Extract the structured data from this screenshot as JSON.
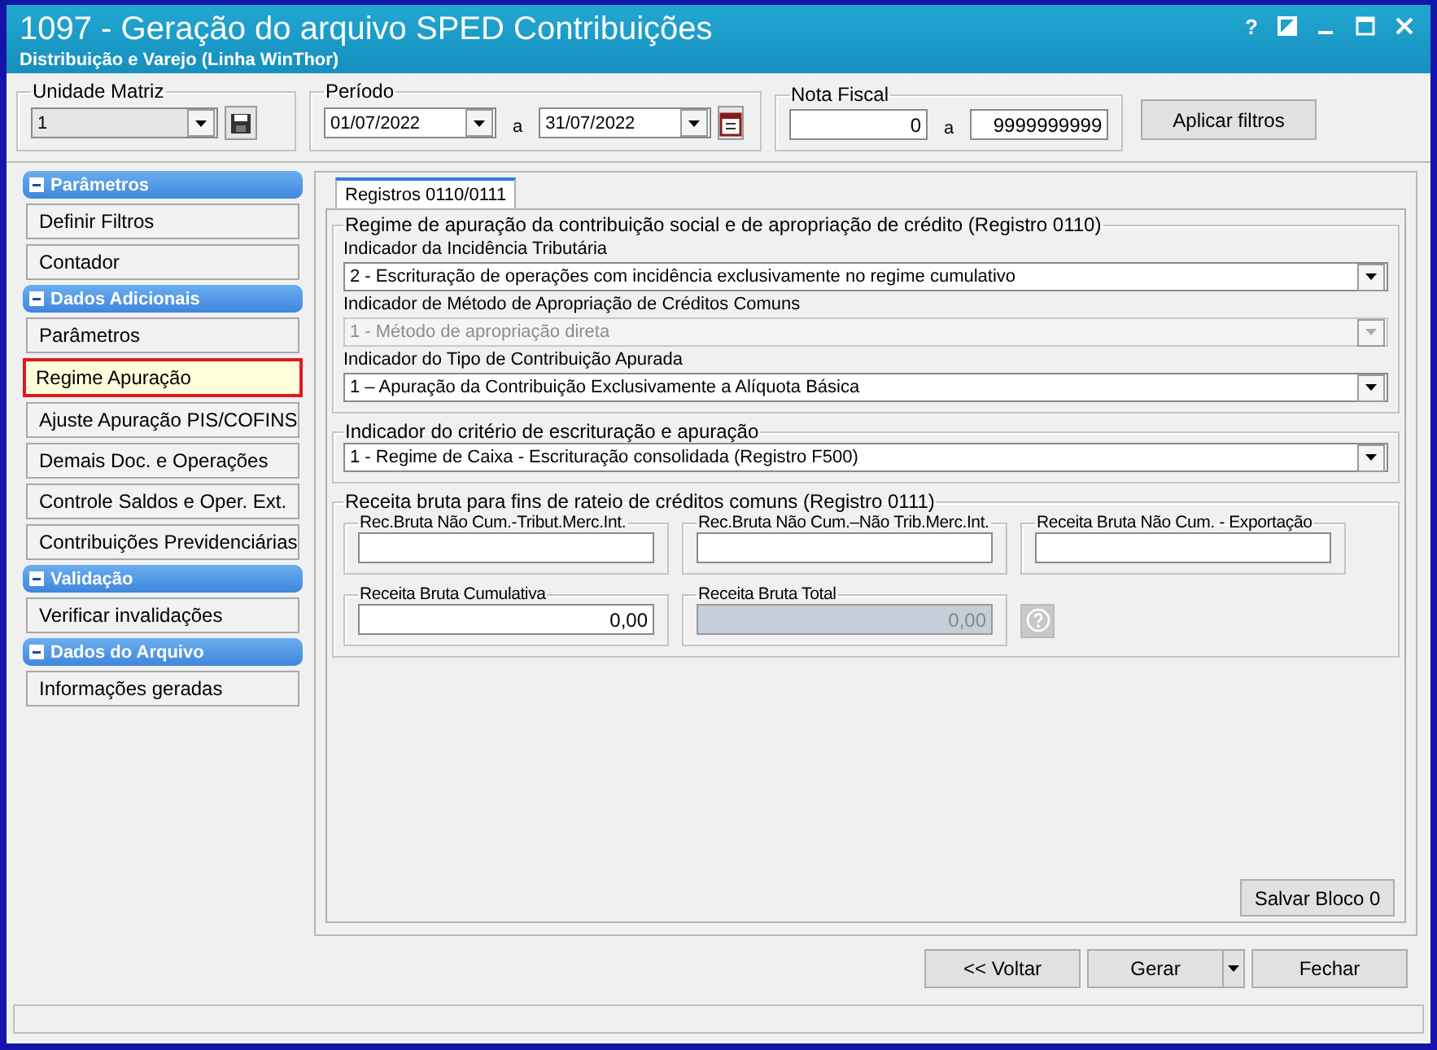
{
  "window": {
    "title": "1097 - Geração do arquivo SPED Contribuições",
    "subtitle": "Distribuição e Varejo (Linha WinThor)",
    "help": "?"
  },
  "filters": {
    "unit": {
      "label": "Unidade Matriz",
      "value": "1"
    },
    "period": {
      "label": "Período",
      "from": "01/07/2022",
      "separator": "a",
      "to": "31/07/2022"
    },
    "invoice": {
      "label": "Nota Fiscal",
      "from": "0",
      "separator": "a",
      "to": "9999999999"
    },
    "apply_button": "Aplicar filtros"
  },
  "sidebar": {
    "groups": [
      {
        "title": "Parâmetros",
        "items": [
          {
            "label": "Definir Filtros",
            "selected": false
          },
          {
            "label": "Contador",
            "selected": false
          }
        ]
      },
      {
        "title": "Dados Adicionais",
        "items": [
          {
            "label": "Parâmetros",
            "selected": false
          },
          {
            "label": "Regime Apuração",
            "selected": true
          },
          {
            "label": "Ajuste Apuração PIS/COFINS",
            "selected": false
          },
          {
            "label": "Demais Doc. e Operações",
            "selected": false
          },
          {
            "label": "Controle Saldos e Oper. Ext.",
            "selected": false
          },
          {
            "label": "Contribuições Previdenciárias",
            "selected": false
          }
        ]
      },
      {
        "title": "Validação",
        "items": [
          {
            "label": "Verificar invalidações",
            "selected": false
          }
        ]
      },
      {
        "title": "Dados do Arquivo",
        "items": [
          {
            "label": "Informações geradas",
            "selected": false
          }
        ]
      }
    ]
  },
  "tabs": [
    {
      "label": "Registros 0110/0111",
      "selected": true
    }
  ],
  "regime_group": {
    "title": "Regime de apuração da contribuição social e de apropriação de crédito (Registro 0110)",
    "fields": [
      {
        "label": "Indicador da Incidência Tributária",
        "value": "2 - Escrituração de operações com incidência exclusivamente no regime cumulativo",
        "disabled": false
      },
      {
        "label": "Indicador de Método de Apropriação de Créditos Comuns",
        "value": "1 - Método de apropriação direta",
        "disabled": true
      },
      {
        "label": "Indicador do Tipo de Contribuição Apurada",
        "value": "1 – Apuração da Contribuição Exclusivamente a Alíquota Básica",
        "disabled": false
      }
    ]
  },
  "criterion_group": {
    "title": "Indicador do critério de escrituração e apuração",
    "value": "1 - Regime de Caixa - Escrituração consolidada (Registro F500)",
    "disabled": false
  },
  "revenue_group": {
    "title": "Receita bruta para fins de rateio de créditos comuns (Registro 0111)",
    "rows": [
      [
        {
          "label": "Rec.Bruta Não Cum.-Tribut.Merc.Int.",
          "disabled": false
        },
        {
          "label": "Rec.Bruta Não Cum.–Não Trib.Merc.Int.",
          "disabled": false
        },
        {
          "label": "Receita Bruta Não Cum. - Exportação",
          "disabled": false
        }
      ],
      [
        {
          "label": "Receita Bruta Cumulativa",
          "value": "0,00",
          "disabled": false
        },
        {
          "label": "Receita Bruta Total",
          "value": "0,00",
          "disabled": true
        }
      ]
    ]
  },
  "save_button": "Salvar Bloco 0",
  "footer_buttons": [
    {
      "label": "<< Voltar",
      "kind": "plain"
    },
    {
      "label": "Gerar",
      "kind": "split"
    },
    {
      "label": "Fechar",
      "kind": "plain"
    }
  ]
}
